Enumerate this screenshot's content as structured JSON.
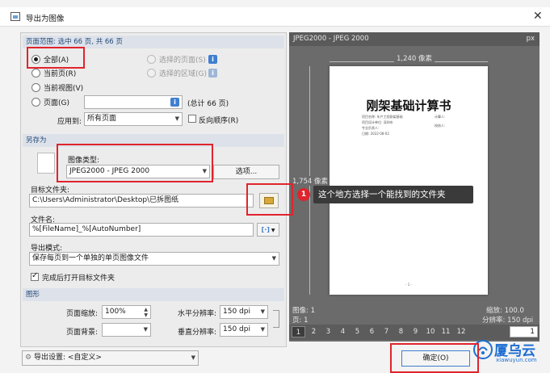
{
  "window": {
    "title": "导出为图像",
    "icon": "image-export-icon",
    "close_icon": "close-icon"
  },
  "page_range": {
    "header": "页面范围: 选中 66 页, 共 66 页",
    "all": "全部(A)",
    "current_page": "当前页(R)",
    "current_view": "当前视图(V)",
    "pages": "页面(G)",
    "pages_value": "",
    "pages_total": "(总计 66 页)",
    "selected_pages": "选择的页面(S)",
    "selected_area": "选择的区域(G)",
    "apply_to_label": "应用到:",
    "apply_to_value": "所有页面",
    "reverse_order": "反向顺序(R)"
  },
  "save_as": {
    "header": "另存为",
    "image_type_label": "图像类型:",
    "image_type_value": "JPEG2000 - JPEG 2000",
    "options_button": "选项...",
    "target_folder_label": "目标文件夹:",
    "target_folder_value": "C:\\Users\\Administrator\\Desktop\\已拆图纸",
    "filename_label": "文件名:",
    "filename_value": "%[FileName]_%[AutoNumber]",
    "export_mode_label": "导出模式:",
    "export_mode_value": "保存每页到一个单独的单页图像文件",
    "open_folder_label": "完成后打开目标文件夹"
  },
  "graphics": {
    "header": "图形",
    "page_zoom_label": "页面缩放:",
    "page_zoom_value": "100%",
    "page_bg_label": "页面背景:",
    "h_res_label": "水平分辨率:",
    "h_res_value": "150 dpi",
    "v_res_label": "垂直分辨率:",
    "v_res_value": "150 dpi"
  },
  "preview": {
    "header": "JPEG2000 - JPEG 2000",
    "unit": "px",
    "width_label": "1,240 像素",
    "height_label": "1,754 像素",
    "doc_title": "刚架基础计算书",
    "doc_lines": [
      "项目名称: 车户工程刚架基础",
      "计算人:",
      "项目设计单位: 深圳市",
      "校核人:",
      "专业负责人:",
      "日期: 2022-08-02"
    ],
    "page_footer": "- 1 -",
    "images_label": "图像: 1",
    "page_label": "页: 1",
    "zoom_label": "缩放: 100.0",
    "resolution_label": "分辨率: 150 dpi",
    "page_numbers": [
      "1",
      "2",
      "3",
      "4",
      "5",
      "6",
      "7",
      "8",
      "9",
      "10",
      "11",
      "12"
    ],
    "page_input": "1"
  },
  "annotation": {
    "number": "1",
    "text": "这个地方选择一个能找到的文件夹"
  },
  "footer": {
    "export_settings_value": "导出设置: <自定义>",
    "ok_button": "确定(O)"
  },
  "watermark": {
    "brand": "厦乌云",
    "sub": "xiawuyun.com"
  },
  "colors": {
    "accent": "#3f7fd0",
    "annotation_red": "#e0242d",
    "preview_bg": "#6b6b6b"
  }
}
